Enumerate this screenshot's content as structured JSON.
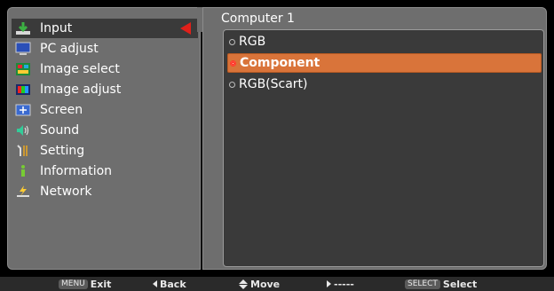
{
  "menu": {
    "items": [
      {
        "label": "Input",
        "icon": "input-icon",
        "selected": true
      },
      {
        "label": "PC adjust",
        "icon": "pc-adjust-icon"
      },
      {
        "label": "Image select",
        "icon": "image-select-icon"
      },
      {
        "label": "Image adjust",
        "icon": "image-adjust-icon"
      },
      {
        "label": "Screen",
        "icon": "screen-icon"
      },
      {
        "label": "Sound",
        "icon": "sound-icon"
      },
      {
        "label": "Setting",
        "icon": "setting-icon"
      },
      {
        "label": "Information",
        "icon": "information-icon"
      },
      {
        "label": "Network",
        "icon": "network-icon"
      }
    ]
  },
  "submenu": {
    "title": "Computer 1",
    "options": [
      {
        "label": "RGB"
      },
      {
        "label": "Component",
        "selected": true
      },
      {
        "label": "RGB(Scart)"
      }
    ]
  },
  "help": {
    "exit_key": "MENU",
    "exit_label": "Exit",
    "back_label": "Back",
    "move_label": "Move",
    "next_label": "-----",
    "select_key": "SELECT",
    "select_label": "Select"
  },
  "colors": {
    "panel": "#6e6e6e",
    "highlight": "#d9743a",
    "selected_arrow": "#e0201a"
  }
}
